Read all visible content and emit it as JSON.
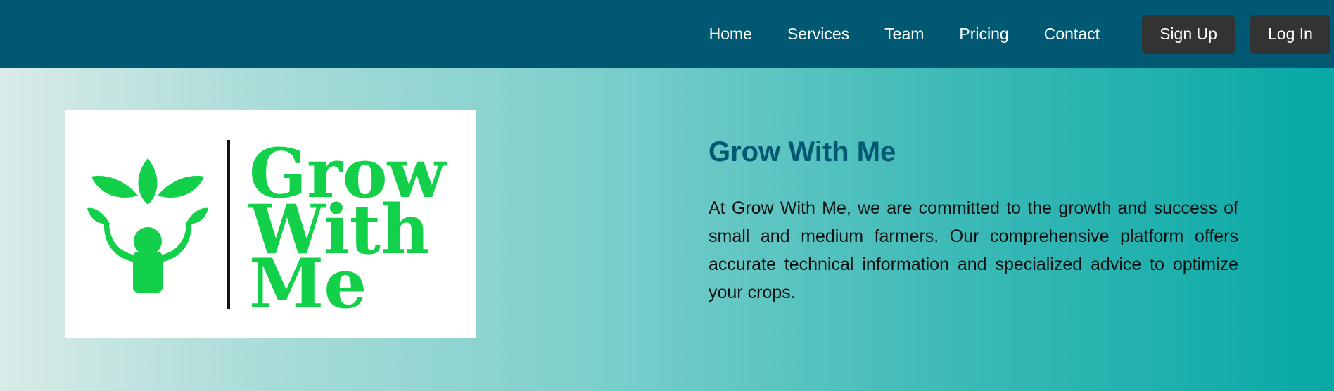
{
  "nav": {
    "links": [
      "Home",
      "Services",
      "Team",
      "Pricing",
      "Contact"
    ],
    "signup_label": "Sign Up",
    "login_label": "Log In"
  },
  "hero": {
    "logo": {
      "icon": "sprout-person-icon",
      "wordmark": [
        "Grow",
        "With",
        "Me"
      ]
    },
    "title": "Grow With Me",
    "description": "At Grow With Me, we are committed to the growth and success of small and medium farmers. Our comprehensive platform offers accurate technical information and specialized advice to optimize your crops."
  },
  "colors": {
    "navbar": "#015872",
    "button": "#333333",
    "title": "#015872",
    "logo_green": "#12d04a",
    "gradient_start": "#d9ebe8",
    "gradient_end": "#06a8a5"
  }
}
